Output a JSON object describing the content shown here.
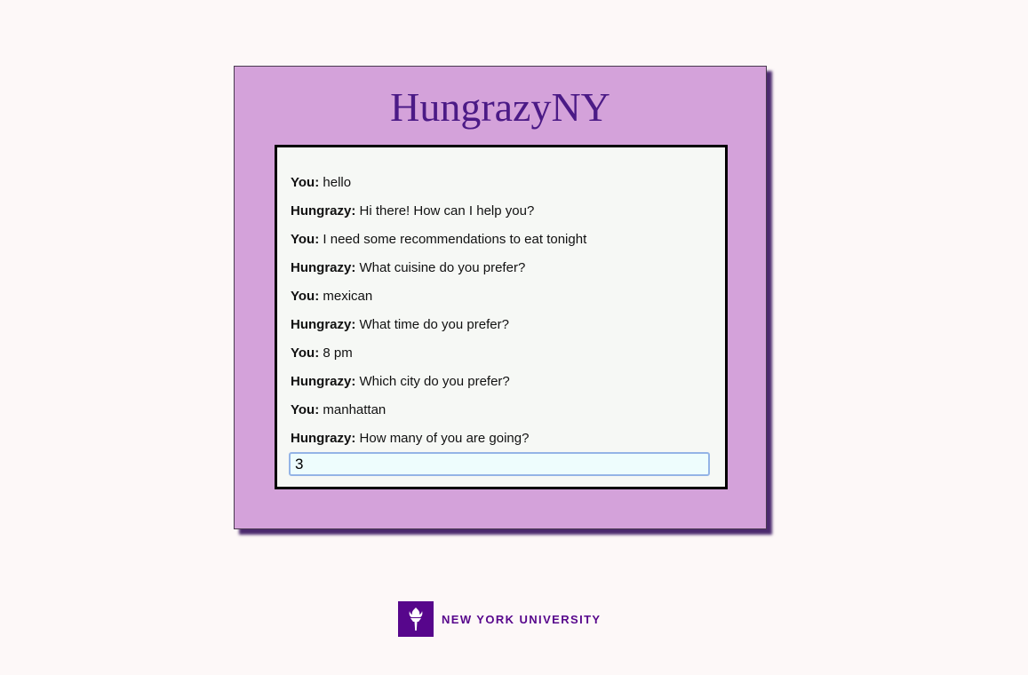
{
  "app": {
    "title": "HungrazyNY"
  },
  "chat": {
    "messages": [
      {
        "sender": "You:",
        "text": "hello"
      },
      {
        "sender": "Hungrazy:",
        "text": "Hi there! How can I help you?"
      },
      {
        "sender": "You:",
        "text": "I need some recommendations to eat tonight"
      },
      {
        "sender": "Hungrazy:",
        "text": "What cuisine do you prefer?"
      },
      {
        "sender": "You:",
        "text": "mexican"
      },
      {
        "sender": "Hungrazy:",
        "text": "What time do you prefer?"
      },
      {
        "sender": "You:",
        "text": "8 pm"
      },
      {
        "sender": "Hungrazy:",
        "text": "Which city do you prefer?"
      },
      {
        "sender": "You:",
        "text": "manhattan"
      },
      {
        "sender": "Hungrazy:",
        "text": "How many of you are going?"
      }
    ],
    "input_value": "3"
  },
  "footer": {
    "logo_icon": "nyu-torch-icon",
    "university_name": "NEW YORK UNIVERSITY"
  },
  "colors": {
    "page_background": "#fdf8f8",
    "panel_background": "#d4a2da",
    "title_color": "#4b1a86",
    "brand_purple": "#57068c",
    "chat_background": "#f6f8f5",
    "input_background": "#eefdfd",
    "input_border": "#94b4e6"
  }
}
